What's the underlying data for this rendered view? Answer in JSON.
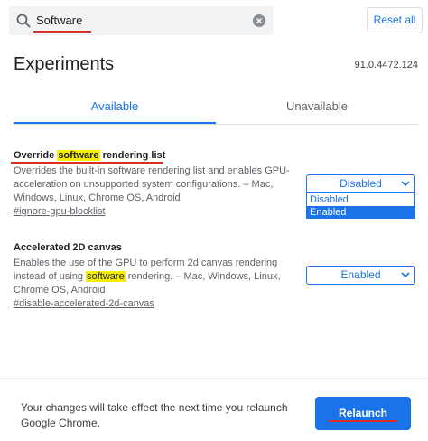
{
  "search": {
    "value": "Software"
  },
  "header": {
    "reset_label": "Reset all"
  },
  "page": {
    "title": "Experiments",
    "version": "91.0.4472.124"
  },
  "tabs": [
    {
      "label": "Available"
    },
    {
      "label": "Unavailable"
    }
  ],
  "experiments": [
    {
      "title_before": "Override ",
      "title_highlight": "software",
      "title_after": " rendering list",
      "description": "Overrides the built-in software rendering list and enables GPU-acceleration on unsupported system configurations. – Mac, Windows, Linux, Chrome OS, Android",
      "link": "#ignore-gpu-blocklist",
      "selected": "Disabled",
      "options": [
        "Disabled",
        "Enabled"
      ]
    },
    {
      "title": "Accelerated 2D canvas",
      "desc_before": "Enables the use of the GPU to perform 2d canvas rendering instead of using ",
      "desc_highlight": "software",
      "desc_after": " rendering. – Mac, Windows, Linux, Chrome OS, Android",
      "link": "#disable-accelerated-2d-canvas",
      "selected": "Enabled"
    }
  ],
  "bottom": {
    "message": "Your changes will take effect the next time you relaunch Google Chrome.",
    "relaunch_label": "Relaunch"
  },
  "colors": {
    "accent": "#1a73e8",
    "highlight": "#f6f000",
    "annotation": "#d93025"
  },
  "icons": [
    "search-icon",
    "clear-icon",
    "chevron-down-icon"
  ]
}
